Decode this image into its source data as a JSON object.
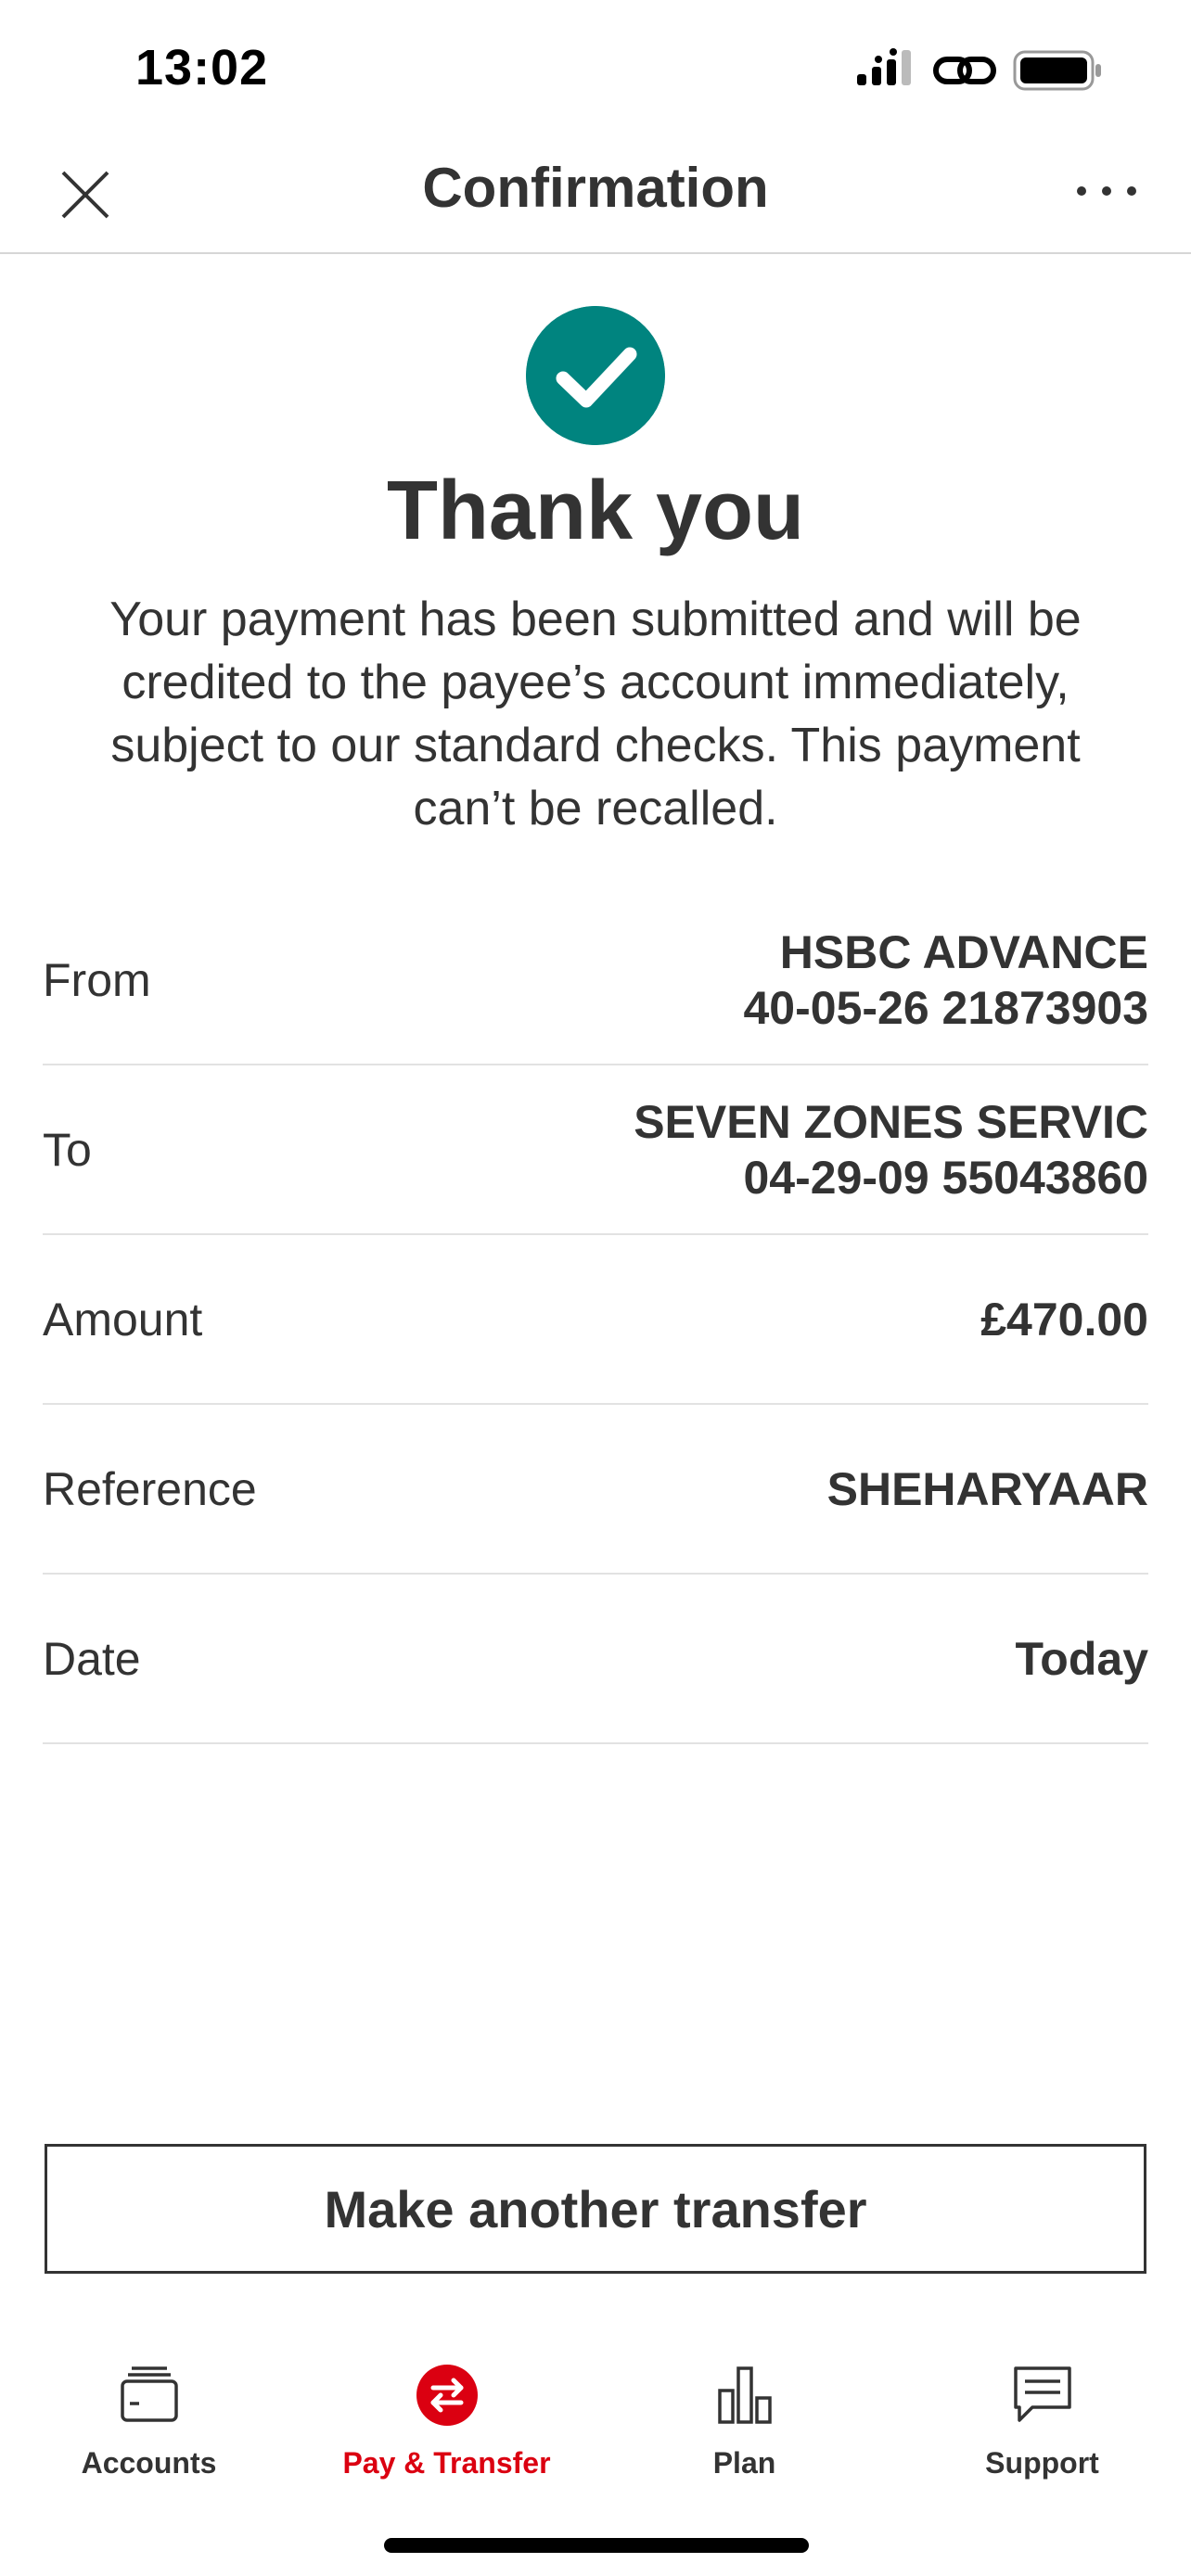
{
  "status_bar": {
    "time": "13:02"
  },
  "header": {
    "title": "Confirmation"
  },
  "success": {
    "title": "Thank you",
    "message": "Your payment has been submitted and will be credited to the payee’s account immediately, subject to our standard checks. This payment can’t be recalled."
  },
  "details": {
    "from": {
      "label": "From",
      "line1": "HSBC ADVANCE",
      "line2": "40-05-26 21873903"
    },
    "to": {
      "label": "To",
      "line1": "SEVEN ZONES SERVIC",
      "line2": "04-29-09 55043860"
    },
    "amount": {
      "label": "Amount",
      "value": "£470.00"
    },
    "reference": {
      "label": "Reference",
      "value": "SHEHARYAAR"
    },
    "date": {
      "label": "Date",
      "value": "Today"
    }
  },
  "cta": {
    "label": "Make another transfer"
  },
  "tabbar": {
    "tabs": [
      {
        "label": "Accounts",
        "icon": "wallet-icon"
      },
      {
        "label": "Pay & Transfer",
        "icon": "transfer-icon",
        "active": true
      },
      {
        "label": "Plan",
        "icon": "bar-chart-icon"
      },
      {
        "label": "Support",
        "icon": "chat-icon"
      }
    ]
  },
  "colors": {
    "success": "#00847f",
    "brand_red": "#db0011",
    "text": "#333333"
  }
}
